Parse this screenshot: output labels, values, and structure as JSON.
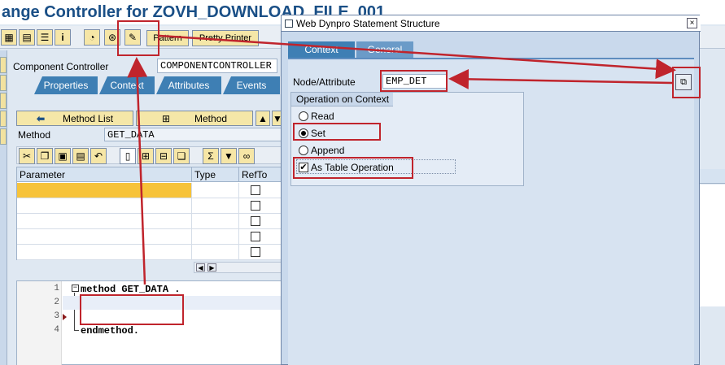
{
  "window": {
    "title": "ange Controller for ZOVH_DOWNLOAD_FILE_001"
  },
  "toolbar": {
    "pattern_label": "Pattern",
    "pretty_printer_label": "Pretty Printer"
  },
  "component": {
    "label": "Component Controller",
    "value": "COMPONENTCONTROLLER"
  },
  "tabs": [
    {
      "label": "Properties"
    },
    {
      "label": "Context"
    },
    {
      "label": "Attributes"
    },
    {
      "label": "Events"
    }
  ],
  "method_nav": {
    "method_list_label": "Method List",
    "method_label": "Method"
  },
  "method": {
    "label": "Method",
    "value": "GET_DATA"
  },
  "param_table": {
    "headers": [
      "Parameter",
      "Type",
      "RefTo"
    ]
  },
  "editor": {
    "lines": [
      {
        "num": "1",
        "text": "method GET_DATA ."
      },
      {
        "num": "2",
        "text": ""
      },
      {
        "num": "3",
        "text": ""
      },
      {
        "num": "4",
        "text": "endmethod."
      }
    ]
  },
  "dialog": {
    "title": "Web Dynpro Statement Structure",
    "close": "×",
    "tabs": [
      {
        "label": "Context"
      },
      {
        "label": "General"
      }
    ],
    "node_attr_label": "Node/Attribute",
    "node_attr_value": "EMP_DET",
    "group_title": "Operation on Context",
    "options": [
      {
        "label": "Read",
        "checked": false
      },
      {
        "label": "Set",
        "checked": true
      },
      {
        "label": "Append",
        "checked": false
      }
    ],
    "table_op_label": "As Table Operation",
    "table_op_checked": true
  },
  "colors": {
    "annotation_red": "#c0242c",
    "tab_blue": "#3e7fb4",
    "title_blue": "#1a4f86"
  },
  "icons": [
    "grid-icon",
    "print-icon",
    "list-icon",
    "info-icon",
    "pie-icon",
    "find-icon",
    "wand-icon",
    "scissors-icon",
    "copy-icon",
    "paste-icon",
    "undo-icon",
    "new-doc-icon",
    "insert-row-icon",
    "delete-row-icon",
    "duplicate-icon",
    "sum-icon",
    "filter-icon",
    "binoculars-icon",
    "left-arrow-icon",
    "hierarchy-icon",
    "up-arrow-icon",
    "down-arrow-icon",
    "value-help-icon"
  ]
}
